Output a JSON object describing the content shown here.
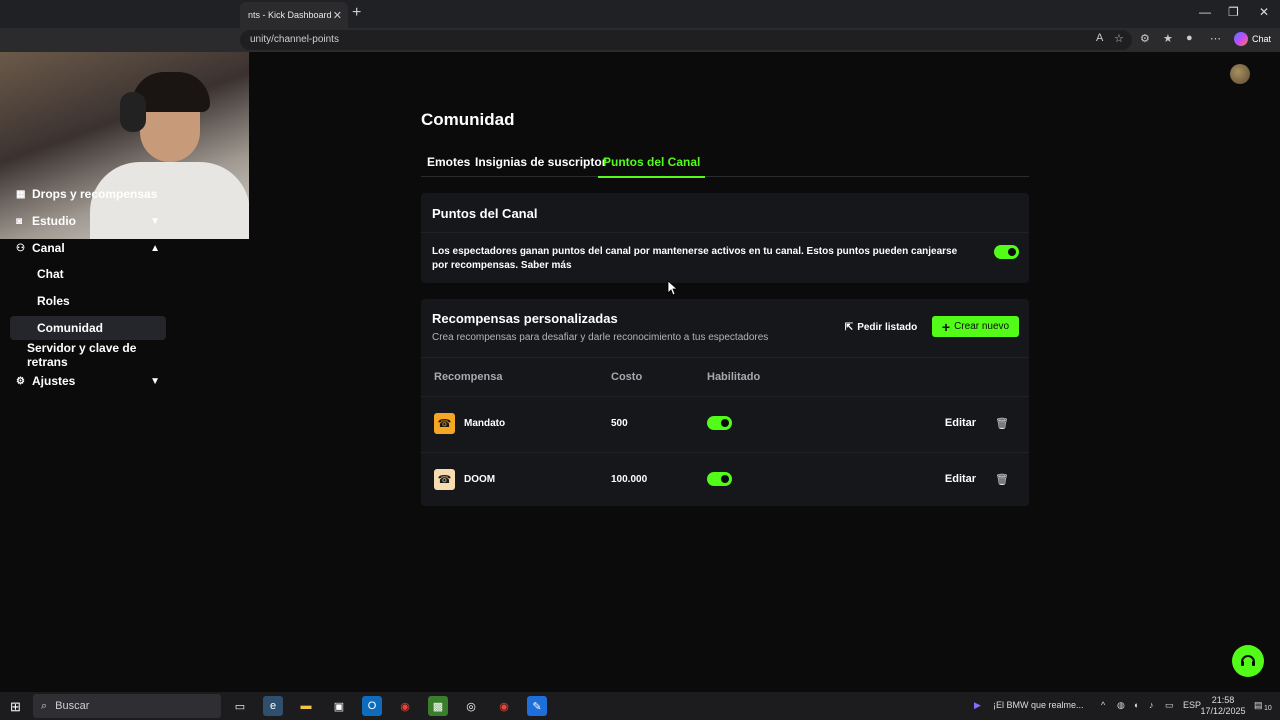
{
  "browser": {
    "tab_title": "nts - Kick Dashboard",
    "tab_close": "✕",
    "new_tab": "+",
    "url": "unity/channel-points",
    "chat_label": "Chat",
    "window_controls": [
      "—",
      "❐",
      "✕"
    ]
  },
  "sidebar": {
    "items": [
      {
        "label": "Drops y recompensas",
        "icon": "gift-icon"
      },
      {
        "label": "Estudio",
        "icon": "camera-icon",
        "chevron": "down"
      },
      {
        "label": "Canal",
        "icon": "users-icon",
        "chevron": "up"
      },
      {
        "label": "Chat"
      },
      {
        "label": "Roles"
      },
      {
        "label": "Comunidad",
        "active": true
      },
      {
        "label": "Servidor y clave de retrans"
      },
      {
        "label": "Ajustes",
        "icon": "gear-icon",
        "chevron": "down"
      }
    ]
  },
  "page": {
    "title": "Comunidad",
    "tabs": [
      {
        "label": "Emotes"
      },
      {
        "label": "Insignias de suscriptor"
      },
      {
        "label": "Puntos del Canal",
        "active": true
      }
    ]
  },
  "channel_points": {
    "title": "Puntos del Canal",
    "description": "Los espectadores ganan puntos del canal por mantenerse activos en tu canal. Estos puntos pueden canjearse por recompensas. Saber más",
    "enabled": true
  },
  "custom_rewards": {
    "title": "Recompensas personalizadas",
    "subtitle": "Crea recompensas para desafiar y darle reconocimiento a tus espectadores",
    "request_list_label": "Pedir listado",
    "create_new_label": "Crear nuevo",
    "columns": [
      "Recompensa",
      "Costo",
      "Habilitado"
    ],
    "rows": [
      {
        "name": "Mandato",
        "cost": "500",
        "enabled": true,
        "icon_color": "#f5a623",
        "edit_label": "Editar"
      },
      {
        "name": "DOOM",
        "cost": "100.000",
        "enabled": true,
        "icon_color": "#f7dcb0",
        "edit_label": "Editar"
      }
    ]
  },
  "taskbar": {
    "search_placeholder": "Buscar",
    "news": "¡El BMW que realme...",
    "lang": "ESP",
    "time": "21:58",
    "date": "17/12/2025",
    "notifications": "10"
  },
  "colors": {
    "accent": "#53fc18",
    "background": "#0b0b0c",
    "card": "#16171a"
  }
}
